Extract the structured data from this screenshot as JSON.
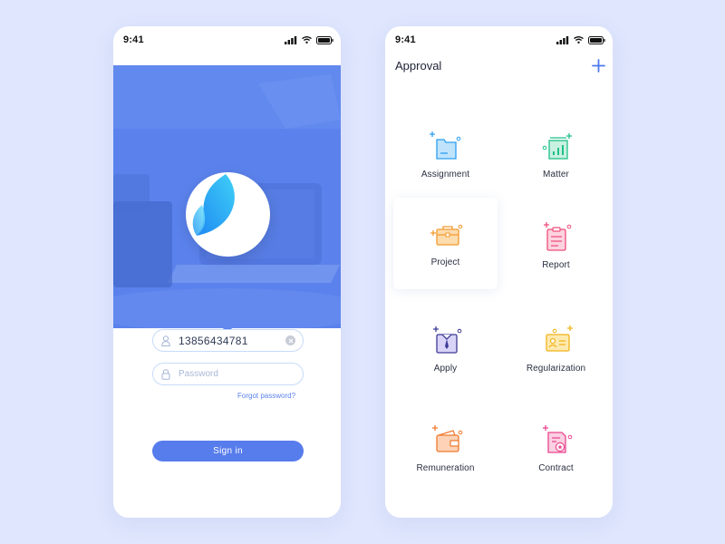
{
  "login": {
    "status_time": "9:41",
    "phone_value": "13856434781",
    "password_placeholder": "Password",
    "forgot_label": "Forgot password?",
    "signin_label": "Sign in"
  },
  "approval": {
    "status_time": "9:41",
    "title": "Approval",
    "items": [
      {
        "label": "Assignment",
        "icon": "folder-icon"
      },
      {
        "label": "Matter",
        "icon": "chart-icon"
      },
      {
        "label": "Project",
        "icon": "briefcase-icon"
      },
      {
        "label": "Report",
        "icon": "clipboard-icon"
      },
      {
        "label": "Apply",
        "icon": "shirt-tie-icon"
      },
      {
        "label": "Regularization",
        "icon": "id-card-icon"
      },
      {
        "label": "Remuneration",
        "icon": "wallet-icon"
      },
      {
        "label": "Contract",
        "icon": "contract-icon"
      }
    ]
  },
  "colors": {
    "background": "#dfe6fd",
    "primary": "#5b82ec",
    "field_border": "#c6dafb"
  }
}
